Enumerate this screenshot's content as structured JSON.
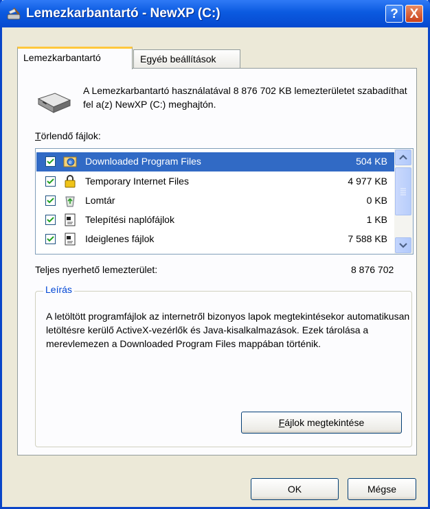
{
  "window": {
    "title": "Lemezkarbantartó - NewXP (C:)",
    "help_label": "?",
    "close_label": "X"
  },
  "tabs": [
    {
      "label": "Lemezkarbantartó",
      "active": true
    },
    {
      "label": "Egyéb beállítások",
      "active": false
    }
  ],
  "description": "A Lemezkarbantartó használatával 8 876 702 KB lemezterületet szabadíthat fel a(z) NewXP (C:) meghajtón.",
  "files_to_delete": {
    "label_first": "T",
    "label_rest": "örlendő fájlok:",
    "items": [
      {
        "name": "Downloaded Program Files",
        "size": "504 KB",
        "checked": true,
        "selected": true,
        "icon": "downloaded-files-icon"
      },
      {
        "name": "Temporary Internet Files",
        "size": "4 977 KB",
        "checked": true,
        "selected": false,
        "icon": "lock-icon"
      },
      {
        "name": "Lomtár",
        "size": "0 KB",
        "checked": true,
        "selected": false,
        "icon": "recycle-bin-icon"
      },
      {
        "name": "Telepítési naplófájlok",
        "size": "1 KB",
        "checked": true,
        "selected": false,
        "icon": "log-file-icon"
      },
      {
        "name": "Ideiglenes fájlok",
        "size": "7 588 KB",
        "checked": true,
        "selected": false,
        "icon": "temp-file-icon"
      }
    ]
  },
  "total": {
    "label": "Teljes nyerhető lemezterület:",
    "value": "8 876 702"
  },
  "group": {
    "title": "Leírás",
    "text": "A letöltött programfájlok az internetről bizonyos lapok megtekintésekor automatikusan letöltésre kerülő ActiveX-vezérlők és Java-kisalkalmazások. Ezek tárolása a merevlemezen a Downloaded Program Files mappában történik."
  },
  "buttons": {
    "view_files_first": "F",
    "view_files_rest": "ájlok megtekintése",
    "ok": "OK",
    "cancel": "Mégse"
  },
  "colors": {
    "titlebar": "#0b5ae0",
    "selection": "#316ac5",
    "group_title": "#0046d5"
  }
}
